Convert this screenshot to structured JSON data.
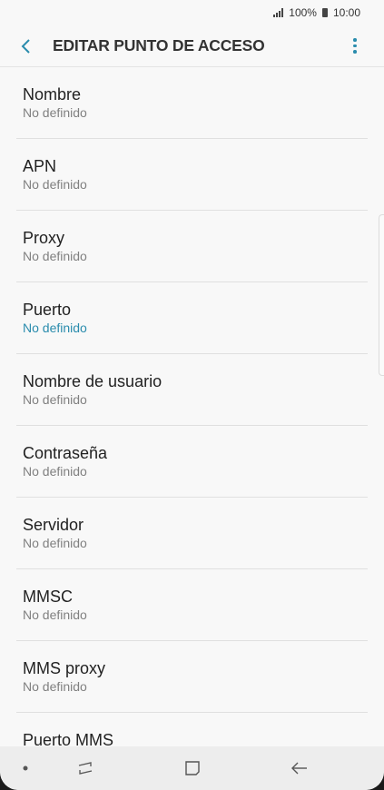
{
  "status_bar": {
    "battery_percent": "100%",
    "time": "10:00"
  },
  "header": {
    "title": "EDITAR PUNTO DE ACCESO"
  },
  "rows": [
    {
      "label": "Nombre",
      "value": "No definido"
    },
    {
      "label": "APN",
      "value": "No definido"
    },
    {
      "label": "Proxy",
      "value": "No definido"
    },
    {
      "label": "Puerto",
      "value": "No definido",
      "highlighted": true
    },
    {
      "label": "Nombre de usuario",
      "value": "No definido"
    },
    {
      "label": "Contraseña",
      "value": "No definido"
    },
    {
      "label": "Servidor",
      "value": "No definido"
    },
    {
      "label": "MMSC",
      "value": "No definido"
    },
    {
      "label": "MMS proxy",
      "value": "No definido"
    },
    {
      "label": "Puerto MMS",
      "value": ""
    }
  ],
  "nav_bar": {
    "icons": [
      "dot-icon",
      "recents-icon",
      "home-icon",
      "back-icon"
    ]
  },
  "colors": {
    "accent": "#2a8cad",
    "background": "#f8f8f8",
    "nav_background": "#ededed"
  }
}
